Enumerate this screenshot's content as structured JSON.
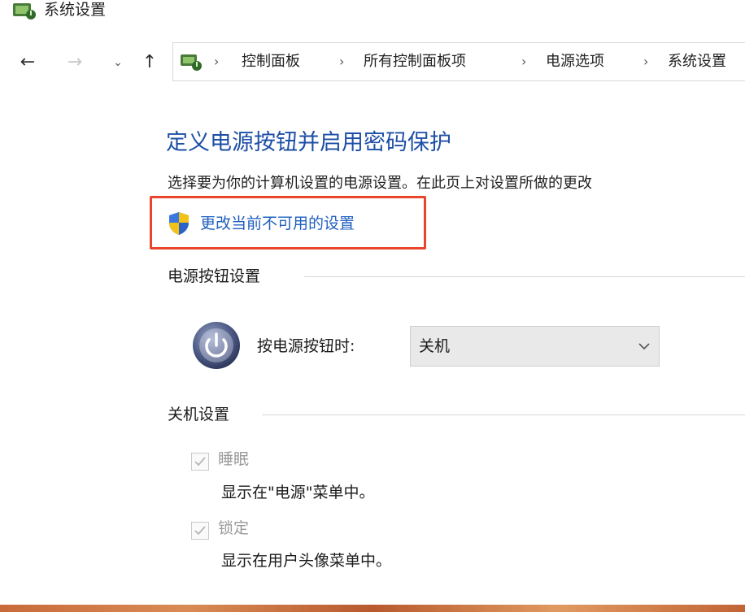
{
  "window": {
    "title": "系统设置",
    "icon": "power-options-icon"
  },
  "nav": {
    "back": "←",
    "forward": "→",
    "recent": "⌄",
    "up": "↑",
    "breadcrumb": [
      "控制面板",
      "所有控制面板项",
      "电源选项",
      "系统设置"
    ],
    "separator": "›"
  },
  "page": {
    "title": "定义电源按钮并启用密码保护",
    "description": "选择要为你的计算机设置的电源设置。在此页上对设置所做的更改",
    "change_link": "更改当前不可用的设置",
    "highlight_color": "#e8452a",
    "link_color": "#1f5fbf",
    "title_color": "#1e4fa6"
  },
  "power_section": {
    "label": "电源按钮设置",
    "row_label": "按电源按钮时:",
    "selected": "关机"
  },
  "shutdown_section": {
    "label": "关机设置",
    "items": [
      {
        "label": "睡眠",
        "description": "显示在\"电源\"菜单中。",
        "checked": true
      },
      {
        "label": "锁定",
        "description": "显示在用户头像菜单中。",
        "checked": true
      }
    ]
  }
}
